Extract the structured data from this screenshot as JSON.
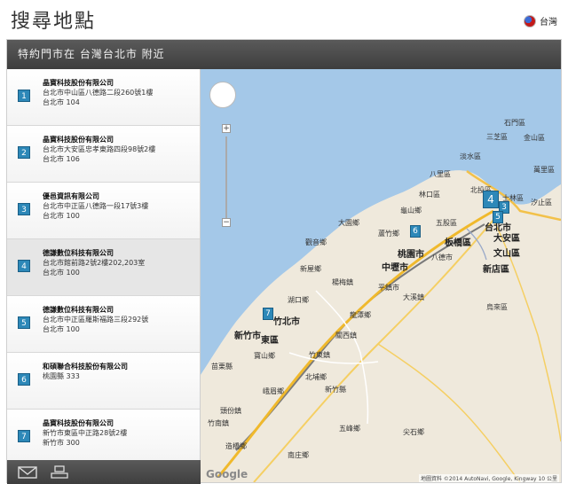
{
  "header": {
    "title": "搜尋地點",
    "region_label": "台灣"
  },
  "panel": {
    "title": "特約門市在 台灣台北市 附近"
  },
  "stores": [
    {
      "num": "1",
      "name": "晶寶科技股份有限公司",
      "address": "台北市中山區八德路二段260號1樓",
      "city": "台北市 104"
    },
    {
      "num": "2",
      "name": "晶寶科技股份有限公司",
      "address": "台北市大安區忠孝東路四段98號2樓",
      "city": "台北市 106"
    },
    {
      "num": "3",
      "name": "優邑資訊有限公司",
      "address": "台北市中正區八德路一段17號3樓",
      "city": "台北市 100"
    },
    {
      "num": "4",
      "name": "德謙數位科技有限公司",
      "address": "台北市館前路2號2樓202,203室",
      "city": "台北市 100"
    },
    {
      "num": "5",
      "name": "德謙數位科技有限公司",
      "address": "台北市中正區羅斯福路三段292號",
      "city": "台北市 100"
    },
    {
      "num": "6",
      "name": "和碩聯合科技股份有限公司",
      "address": "桃園縣 333",
      "city": ""
    },
    {
      "num": "7",
      "name": "晶寶科技股份有限公司",
      "address": "新竹市東區中正路28號2樓",
      "city": "新竹市 300"
    }
  ],
  "footer": {
    "email_icon": "email-icon",
    "print_icon": "print-icon"
  },
  "map": {
    "zoom_in": "+",
    "zoom_out": "−",
    "google": "Google",
    "attribution": "地圖資料 ©2014 AutoNavi, Google, Kingway   10 公里",
    "labels": [
      "石門區",
      "金山區",
      "三芝區",
      "淡水區",
      "萬里區",
      "八里區",
      "林口區",
      "北投區",
      "士林區",
      "汐止區",
      "龜山鄉",
      "五股區",
      "台北市",
      "大安區",
      "文山區",
      "蘆竹鄉",
      "大園鄉",
      "桃園市",
      "板橋區",
      "新店區",
      "觀音鄉",
      "八德市",
      "中壢市",
      "烏來區",
      "新屋鄉",
      "平鎮市",
      "楊梅鎮",
      "湖口鄉",
      "龍潭鄉",
      "大溪鎮",
      "新竹市",
      "東區",
      "竹北市",
      "寶山鄉",
      "竹東鎮",
      "關西鎮",
      "北埔鄉",
      "峨眉鄉",
      "新竹縣",
      "頭份鎮",
      "五峰鄉",
      "尖石鄉",
      "竹南鎮",
      "苗栗縣",
      "南庄鄉",
      "造橋鄉"
    ],
    "markers": [
      {
        "num": "4"
      },
      {
        "num": "3"
      },
      {
        "num": "5"
      },
      {
        "num": "6"
      },
      {
        "num": "7"
      }
    ]
  }
}
